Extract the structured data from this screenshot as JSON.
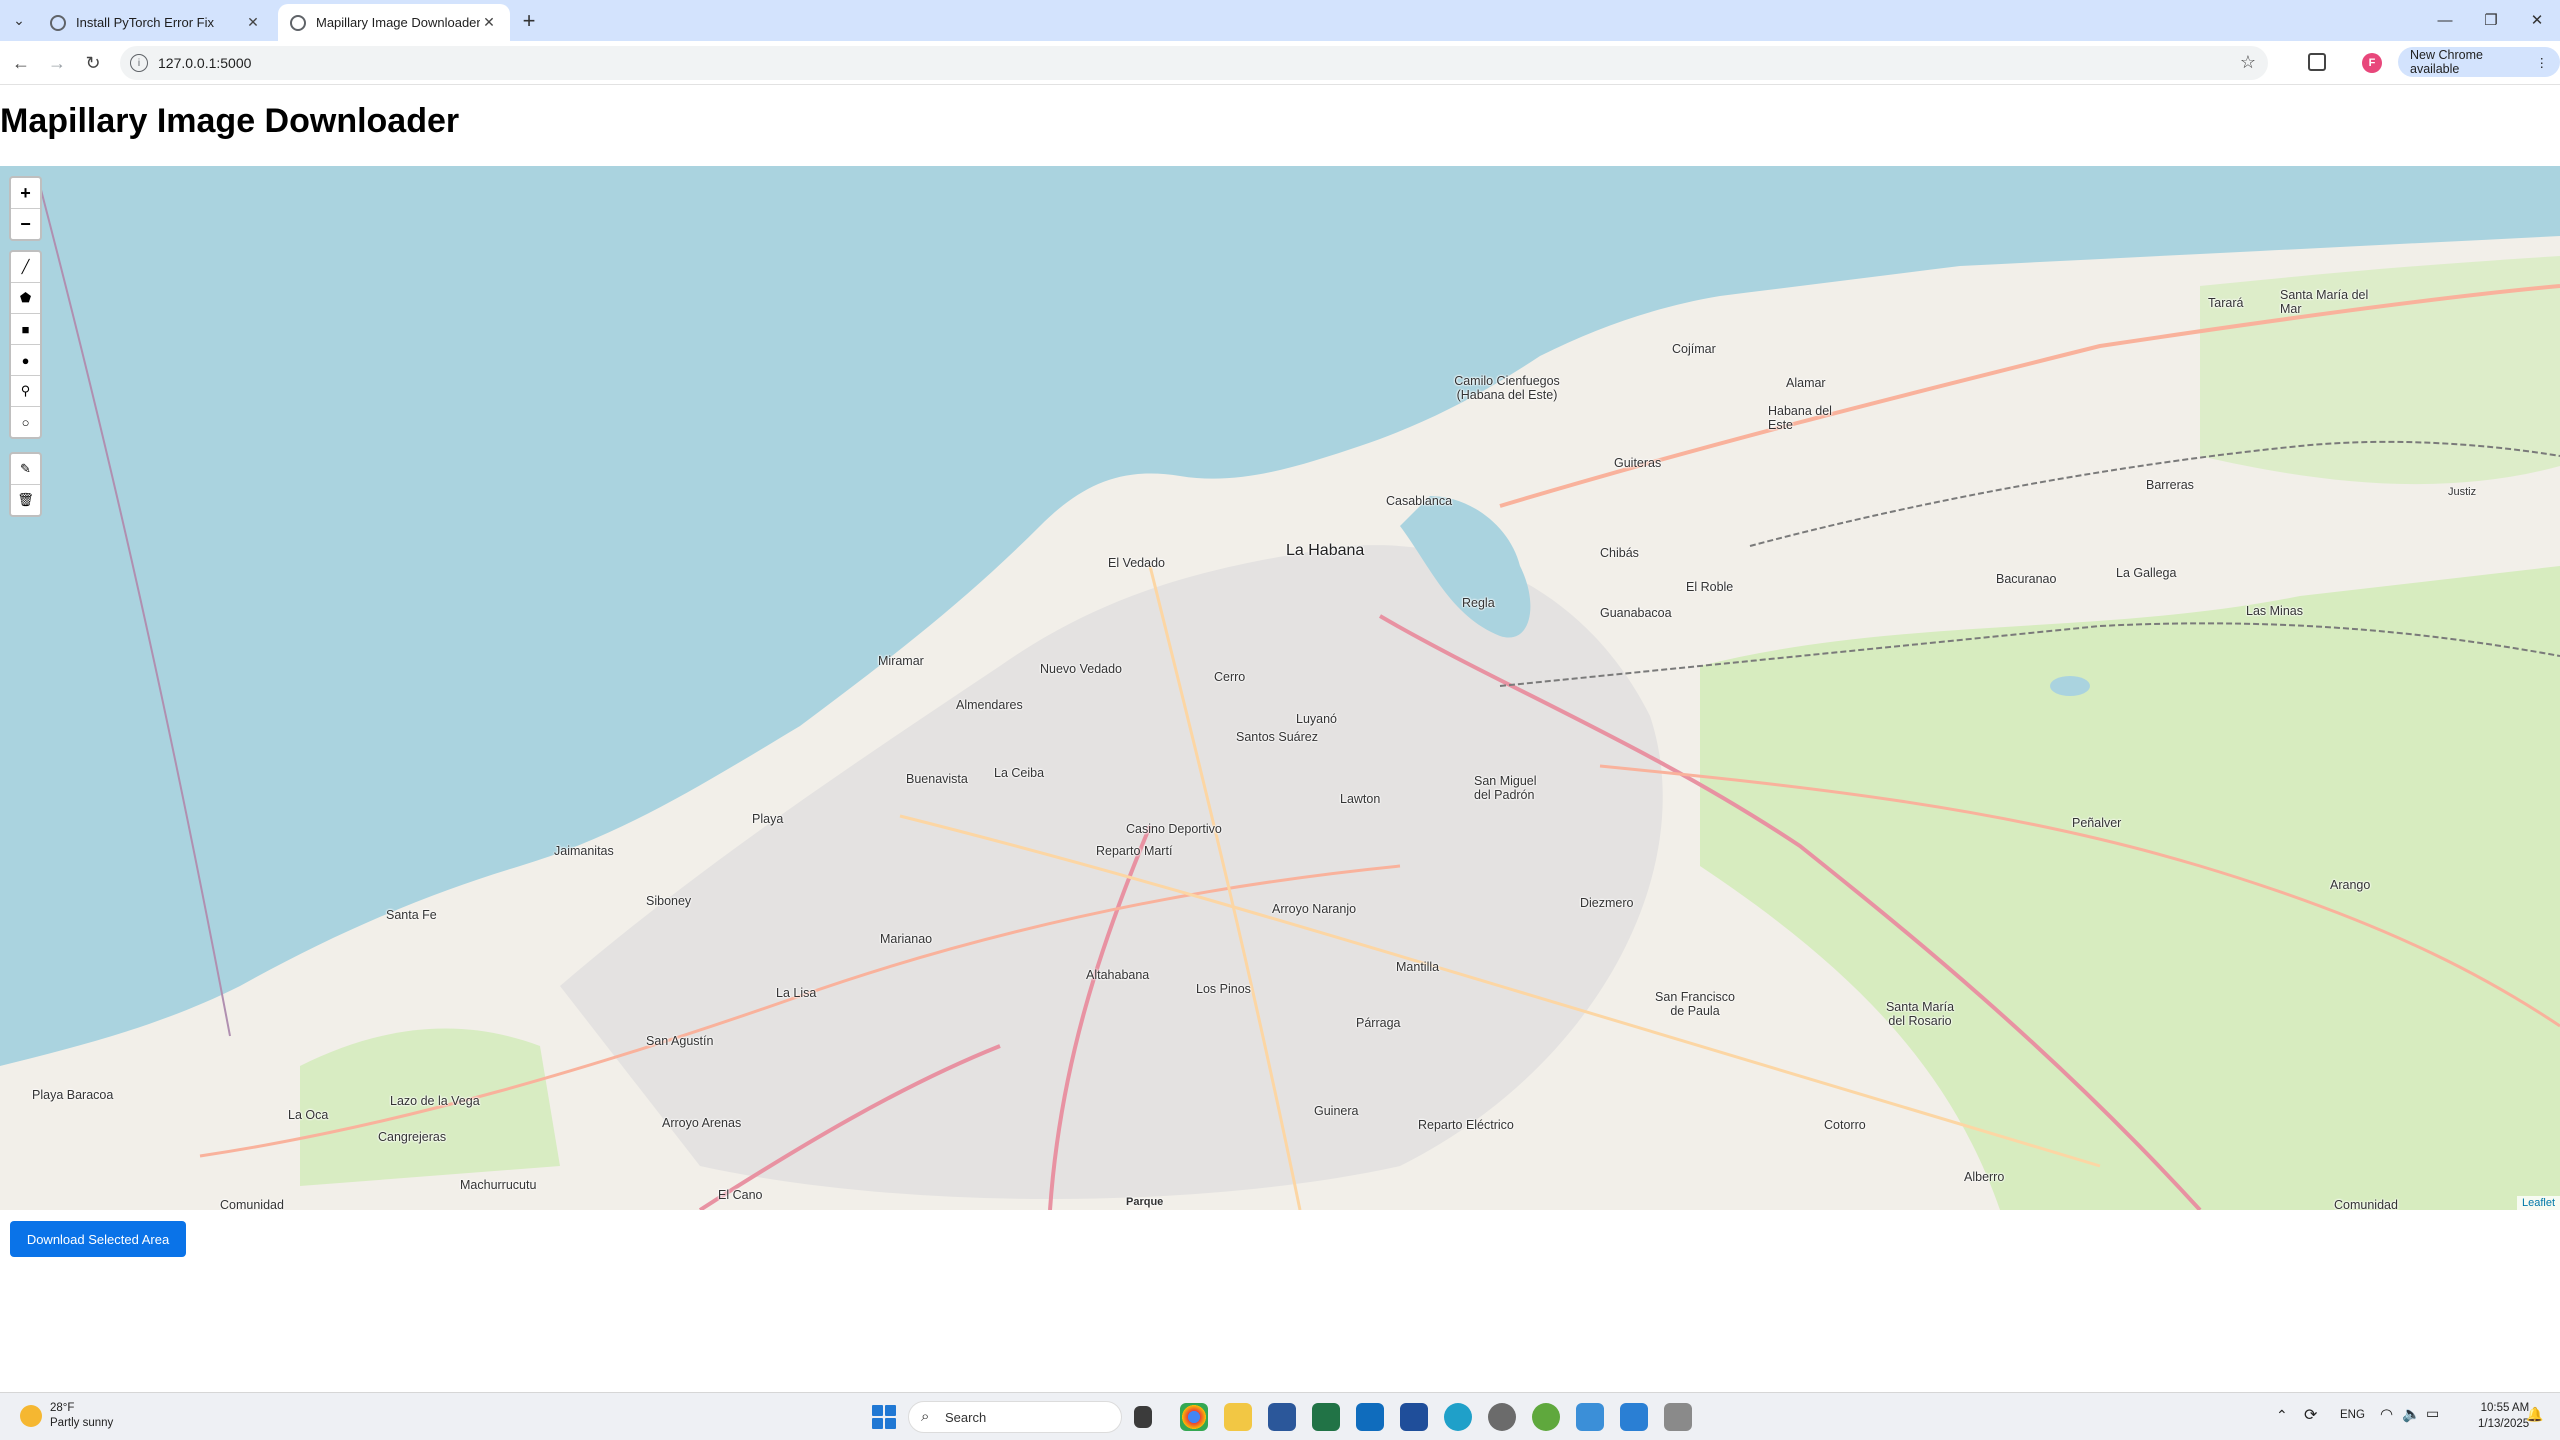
{
  "browser": {
    "tabs": [
      {
        "title": "Install PyTorch Error Fix",
        "active": false
      },
      {
        "title": "Mapillary Image Downloader",
        "active": true
      }
    ],
    "url": "127.0.0.1:5000",
    "profile_initial": "F",
    "new_chrome_label": "New Chrome available"
  },
  "page": {
    "title": "Mapillary Image Downloader",
    "download_button": "Download Selected Area"
  },
  "map": {
    "controls": {
      "zoom_in": "+",
      "zoom_out": "−"
    },
    "draw_tools": [
      "polyline-icon",
      "polygon-icon",
      "rectangle-icon",
      "circle-icon",
      "marker-icon",
      "circlemarker-icon"
    ],
    "edit_tools": [
      "edit-layers-icon",
      "delete-layers-icon"
    ],
    "attribution": "Leaflet",
    "labels": [
      {
        "id": "la-habana",
        "text": "La Habana",
        "big": true
      },
      {
        "id": "el-vedado",
        "text": "El Vedado"
      },
      {
        "id": "miramar",
        "text": "Miramar"
      },
      {
        "id": "nuevo-vedado",
        "text": "Nuevo Vedado"
      },
      {
        "id": "almendares",
        "text": "Almendares"
      },
      {
        "id": "cerro",
        "text": "Cerro"
      },
      {
        "id": "luyano",
        "text": "Luyanó"
      },
      {
        "id": "santos-suarez",
        "text": "Santos Suárez"
      },
      {
        "id": "buenavista",
        "text": "Buenavista"
      },
      {
        "id": "la-ceiba",
        "text": "La Ceiba"
      },
      {
        "id": "playa",
        "text": "Playa"
      },
      {
        "id": "jaimanitas",
        "text": "Jaimanitas"
      },
      {
        "id": "siboney",
        "text": "Siboney"
      },
      {
        "id": "santa-fe",
        "text": "Santa Fe"
      },
      {
        "id": "marianao",
        "text": "Marianao"
      },
      {
        "id": "la-lisa",
        "text": "La Lisa"
      },
      {
        "id": "san-agustin",
        "text": "San Agustín"
      },
      {
        "id": "playa-baracoa",
        "text": "Playa Baracoa"
      },
      {
        "id": "la-oca",
        "text": "La Oca"
      },
      {
        "id": "lazo-de-la-vega",
        "text": "Lazo de la Vega"
      },
      {
        "id": "cangrejeras",
        "text": "Cangrejeras"
      },
      {
        "id": "arroyo-arenas",
        "text": "Arroyo Arenas"
      },
      {
        "id": "machurrucutu",
        "text": "Machurrucutu"
      },
      {
        "id": "el-cano",
        "text": "El Cano"
      },
      {
        "id": "comunidad-w",
        "text": "Comunidad"
      },
      {
        "id": "casino-deportivo",
        "text": "Casino Deportivo"
      },
      {
        "id": "reparto-marti",
        "text": "Reparto Martí"
      },
      {
        "id": "lawton",
        "text": "Lawton"
      },
      {
        "id": "arroyo-naranjo",
        "text": "Arroyo Naranjo"
      },
      {
        "id": "altahabana",
        "text": "Altahabana"
      },
      {
        "id": "los-pinos",
        "text": "Los Pinos"
      },
      {
        "id": "mantilla",
        "text": "Mantilla"
      },
      {
        "id": "parraga",
        "text": "Párraga"
      },
      {
        "id": "guinera",
        "text": "Guinera"
      },
      {
        "id": "reparto-electrico",
        "text": "Reparto Eléctrico"
      },
      {
        "id": "parque",
        "text": "Parque"
      },
      {
        "id": "regla",
        "text": "Regla"
      },
      {
        "id": "casablanca",
        "text": "Casablanca"
      },
      {
        "id": "san-miguel-del-padron",
        "text": "San Miguel del Padrón"
      },
      {
        "id": "diezmero",
        "text": "Diezmero"
      },
      {
        "id": "san-francisco-de-paula",
        "text": "San Francisco de Paula"
      },
      {
        "id": "santa-maria-del-rosario",
        "text": "Santa María del Rosario"
      },
      {
        "id": "cotorro",
        "text": "Cotorro"
      },
      {
        "id": "alberro",
        "text": "Alberro"
      },
      {
        "id": "guanabacoa",
        "text": "Guanabacoa"
      },
      {
        "id": "chibas",
        "text": "Chibás"
      },
      {
        "id": "el-roble",
        "text": "El Roble"
      },
      {
        "id": "guiteras",
        "text": "Guiteras"
      },
      {
        "id": "cojimar",
        "text": "Cojímar"
      },
      {
        "id": "alamar",
        "text": "Alamar"
      },
      {
        "id": "habana-del-este",
        "text": "Habana del Este"
      },
      {
        "id": "camilo-cienfuegos",
        "text": "Camilo Cienfuegos (Habana del Este)"
      },
      {
        "id": "tarara",
        "text": "Tarará"
      },
      {
        "id": "santa-maria-del-mar",
        "text": "Santa María del Mar"
      },
      {
        "id": "barreras",
        "text": "Barreras"
      },
      {
        "id": "bacuranao",
        "text": "Bacuranao"
      },
      {
        "id": "la-gallega",
        "text": "La Gallega"
      },
      {
        "id": "las-minas",
        "text": "Las Minas"
      },
      {
        "id": "penalver",
        "text": "Peñalver"
      },
      {
        "id": "arango",
        "text": "Arango"
      },
      {
        "id": "comunidad-e",
        "text": "Comunidad"
      },
      {
        "id": "justiz",
        "text": "Justiz"
      }
    ]
  },
  "taskbar": {
    "weather_temp": "28°F",
    "weather_desc": "Partly sunny",
    "search_placeholder": "Search",
    "language": "ENG",
    "time": "10:55 AM",
    "date": "1/13/2025"
  }
}
